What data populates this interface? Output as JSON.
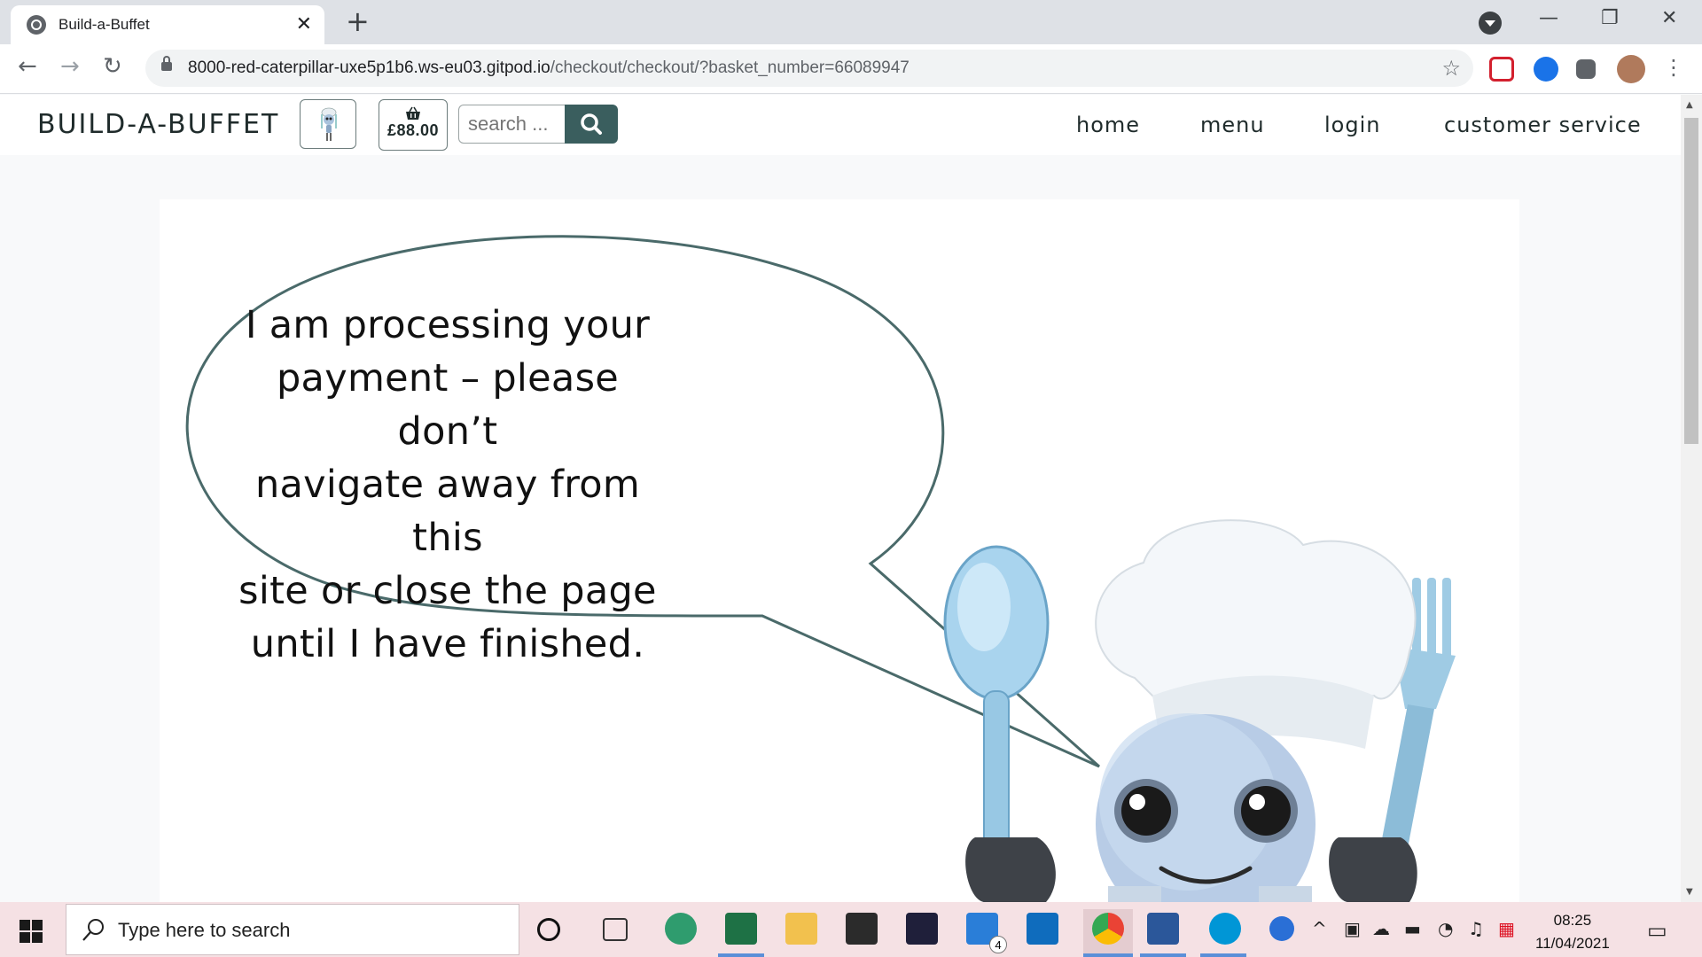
{
  "browser": {
    "tab_title": "Build-a-Buffet",
    "url_host": "8000-red-caterpillar-uxe5p1b6.ws-eu03.gitpod.io",
    "url_path": "/checkout/checkout/?basket_number=66089947",
    "close_glyph": "✕",
    "new_tab_glyph": "+",
    "back_glyph": "←",
    "forward_glyph": "→",
    "reload_glyph": "↻",
    "star_glyph": "☆",
    "minimize_glyph": "—",
    "restore_glyph": "❐",
    "win_close_glyph": "✕",
    "menu_glyph": "⋮"
  },
  "site": {
    "brand": "BUILD-A-BUFFET",
    "basket_icon": "basket-icon",
    "basket_total": "£88.00",
    "search_placeholder": "search ...",
    "nav_links": [
      "home",
      "menu",
      "login",
      "customer service"
    ]
  },
  "message": {
    "lines": [
      "I am processing your",
      "payment – please don’t",
      "navigate away from this",
      "site or close the page",
      "until I have finished."
    ]
  },
  "taskbar": {
    "search_placeholder": "Type here to search",
    "time": "08:25",
    "date": "11/04/2021",
    "mail_badge": "4"
  },
  "colors": {
    "brand_teal": "#3a5e5e",
    "bubble_stroke": "#4a6a6a"
  }
}
